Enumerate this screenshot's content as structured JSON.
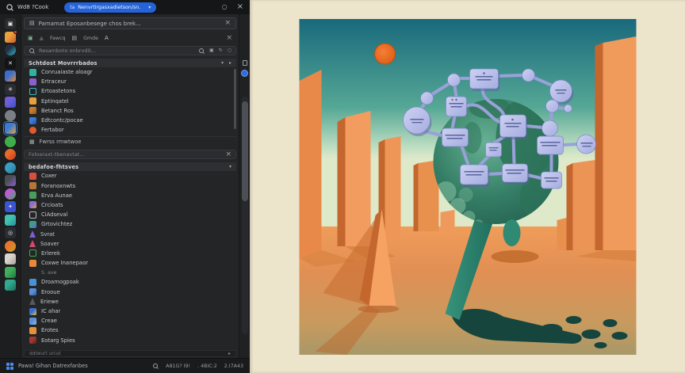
{
  "topbar": {
    "title": "Wd8 ?Cook",
    "pill_icon": "ta",
    "pill_label": "Nenvrtirgasxadietson/sn."
  },
  "panel": {
    "file_input": {
      "value": "Pamamat Eposanbesege chos brek..."
    },
    "toolbar": {
      "label1": "Fawcq",
      "label2": "Gmde",
      "label3": "A"
    },
    "search_main": {
      "placeholder": "Resamboto onbrvdit..."
    },
    "section1": {
      "title": "Schtdost Movrrrbados",
      "items": [
        {
          "label": "Conruaiaste aloagr",
          "color": "#2fb3a0",
          "shape": "square"
        },
        {
          "label": "Ertraceur",
          "color": "#8a5fd0",
          "shape": "square"
        },
        {
          "label": "Ertoastetons",
          "shape": "outline",
          "border": "#3fb9c4"
        },
        {
          "label": "Eptinqatel",
          "color": "#e8a03c",
          "shape": "square"
        },
        {
          "label": "Betanct Ros",
          "color": "#c87a30",
          "shape": "square",
          "color2": "#8a5a20"
        },
        {
          "label": "Edtcontc/pocae",
          "color": "#3a7bd5",
          "shape": "square",
          "color2": "#1f4f9e"
        },
        {
          "label": "Fertabor",
          "color": "#e05a2b",
          "shape": "circle"
        }
      ]
    },
    "link_row": {
      "label": "Fwrss rmwtwoe"
    },
    "search_filter": {
      "placeholder": "Foloaraxt-tbenavtat..."
    },
    "section2": {
      "title": "bedafoe-fhtsves",
      "items": [
        {
          "label": "Coxer",
          "color": "#d94f3f",
          "shape": "square"
        },
        {
          "label": "Foranoxnwts",
          "color": "#b5763a",
          "shape": "square"
        },
        {
          "label": "Erva Aunae",
          "color": "#4a9e5c",
          "shape": "square"
        },
        {
          "label": "Crcioats",
          "color": "#8a6fd0",
          "shape": "square",
          "color2": "#e8a03c"
        },
        {
          "label": "CiAdseval",
          "shape": "outline",
          "border": "#b8bcc0"
        },
        {
          "label": "Grtovichtez",
          "color": "#3a9e8f",
          "shape": "square",
          "color2": "#6a5fd0"
        },
        {
          "label": "Svrat",
          "color": "#7b5fd0",
          "shape": "triangle"
        },
        {
          "label": "Soaver",
          "color": "#d04a6e",
          "shape": "triangle"
        },
        {
          "label": "Erlerek",
          "shape": "outline",
          "border": "#3fae4a"
        },
        {
          "label": "Coxwe Inanepaor",
          "color": "#e8883c",
          "shape": "square"
        },
        {
          "label": "S. ave",
          "shape": "none",
          "dim": true
        },
        {
          "label": "Droamogpoak",
          "color": "#4a90d9",
          "shape": "square"
        },
        {
          "label": "Erooue",
          "color": "#5a8fd5",
          "shape": "square",
          "color2": "#2a5fb5"
        },
        {
          "label": "Eriewe",
          "color": "#55585c",
          "shape": "triangle"
        },
        {
          "label": "IC ahar",
          "color": "#3a6fd0",
          "shape": "square",
          "color2": "#e8c43c"
        },
        {
          "label": "Creae",
          "color": "#5a8fd5",
          "shape": "square",
          "color2": "#9ab8e8"
        },
        {
          "label": "Erotes",
          "color": "#e8913c",
          "shape": "square"
        },
        {
          "label": "Eotarg Spies",
          "color": "#a03a30",
          "shape": "square",
          "color2": "#5a1f1a"
        }
      ]
    },
    "collapsed_row": {
      "label": "ddtwurt urcut"
    }
  },
  "statusbar": {
    "left_label": "Pawa! Gihan Datrexfanbes",
    "shortcut1": "A81G? I9!",
    "shortcut2": ". 4BIC:2",
    "shortcut3": "2.I7A43"
  },
  "rail": {
    "icons": [
      {
        "name": "search-doc",
        "color": "#2a2c2f",
        "glyph": "▣"
      },
      {
        "name": "shop",
        "color": "#e8a23c",
        "color2": "#d05a2a",
        "badge": true
      },
      {
        "name": "clock",
        "color": "#223044",
        "color2": "#2fb9c8",
        "shape": "circle"
      },
      {
        "name": "x-app",
        "color": "#121416",
        "glyph": "✕"
      },
      {
        "name": "bird",
        "color": "#3a6fd0",
        "color2": "#e8883c"
      },
      {
        "name": "gear",
        "color": "#2a2d31",
        "glyph": "✳"
      },
      {
        "name": "music",
        "color": "#6f5fd6",
        "color2": "#3a4fd0"
      },
      {
        "name": "swirl",
        "color": "#7a7f85",
        "shape": "circle"
      },
      {
        "name": "photos",
        "color": "#3a7bd5",
        "color2": "#e8a23c",
        "selected": true
      },
      {
        "name": "android",
        "color": "#3fae4a",
        "shape": "circle"
      },
      {
        "name": "firefox",
        "color": "#e86a2a",
        "color2": "#c43a1e",
        "shape": "circle"
      },
      {
        "name": "globe",
        "color": "#3a9ec4",
        "color2": "#2f7a8e",
        "shape": "circle"
      },
      {
        "name": "stripes",
        "color": "#4a4f54",
        "color2": "#8a5fd0"
      },
      {
        "name": "palette",
        "color": "#b75fd0",
        "color2": "#3fae5c",
        "shape": "circle"
      },
      {
        "name": "star-app",
        "color": "#3a55d0",
        "glyph": "✦"
      },
      {
        "name": "capsule",
        "color": "#3fc4b0",
        "color2": "#2a8ea0"
      },
      {
        "name": "lens",
        "color": "#2a2d31",
        "glyph": "◎"
      },
      {
        "name": "food",
        "color": "#e8762a",
        "color2": "#c4a22a",
        "shape": "circle"
      },
      {
        "name": "clipboard",
        "color": "#d8d5cf",
        "color2": "#a8a49c"
      },
      {
        "name": "leaf",
        "color": "#3fae5c",
        "color2": "#1f7a3c"
      },
      {
        "name": "hook",
        "color": "#2fa98f",
        "color2": "#1f6d5b"
      }
    ]
  },
  "illustration": {
    "description": "retro poster: teal globe with network diagram of lavender nodes, orange monolith buildings, orange sun, cream mat",
    "palette": {
      "mat": "#ece4cb",
      "sky_top": "#19697c",
      "sky_horizon": "#dde9c9",
      "sun": "#e86820",
      "building_light": "#f29c5f",
      "building_dark": "#c4672e",
      "ground_top": "#f09c5a",
      "ground_bottom": "#a89868",
      "globe": "#357e66",
      "node_fill": "#b6bce8",
      "node_edge": "#9aa1d8",
      "shadow_teal": "#16453e",
      "stem": "#2f8a74"
    }
  }
}
